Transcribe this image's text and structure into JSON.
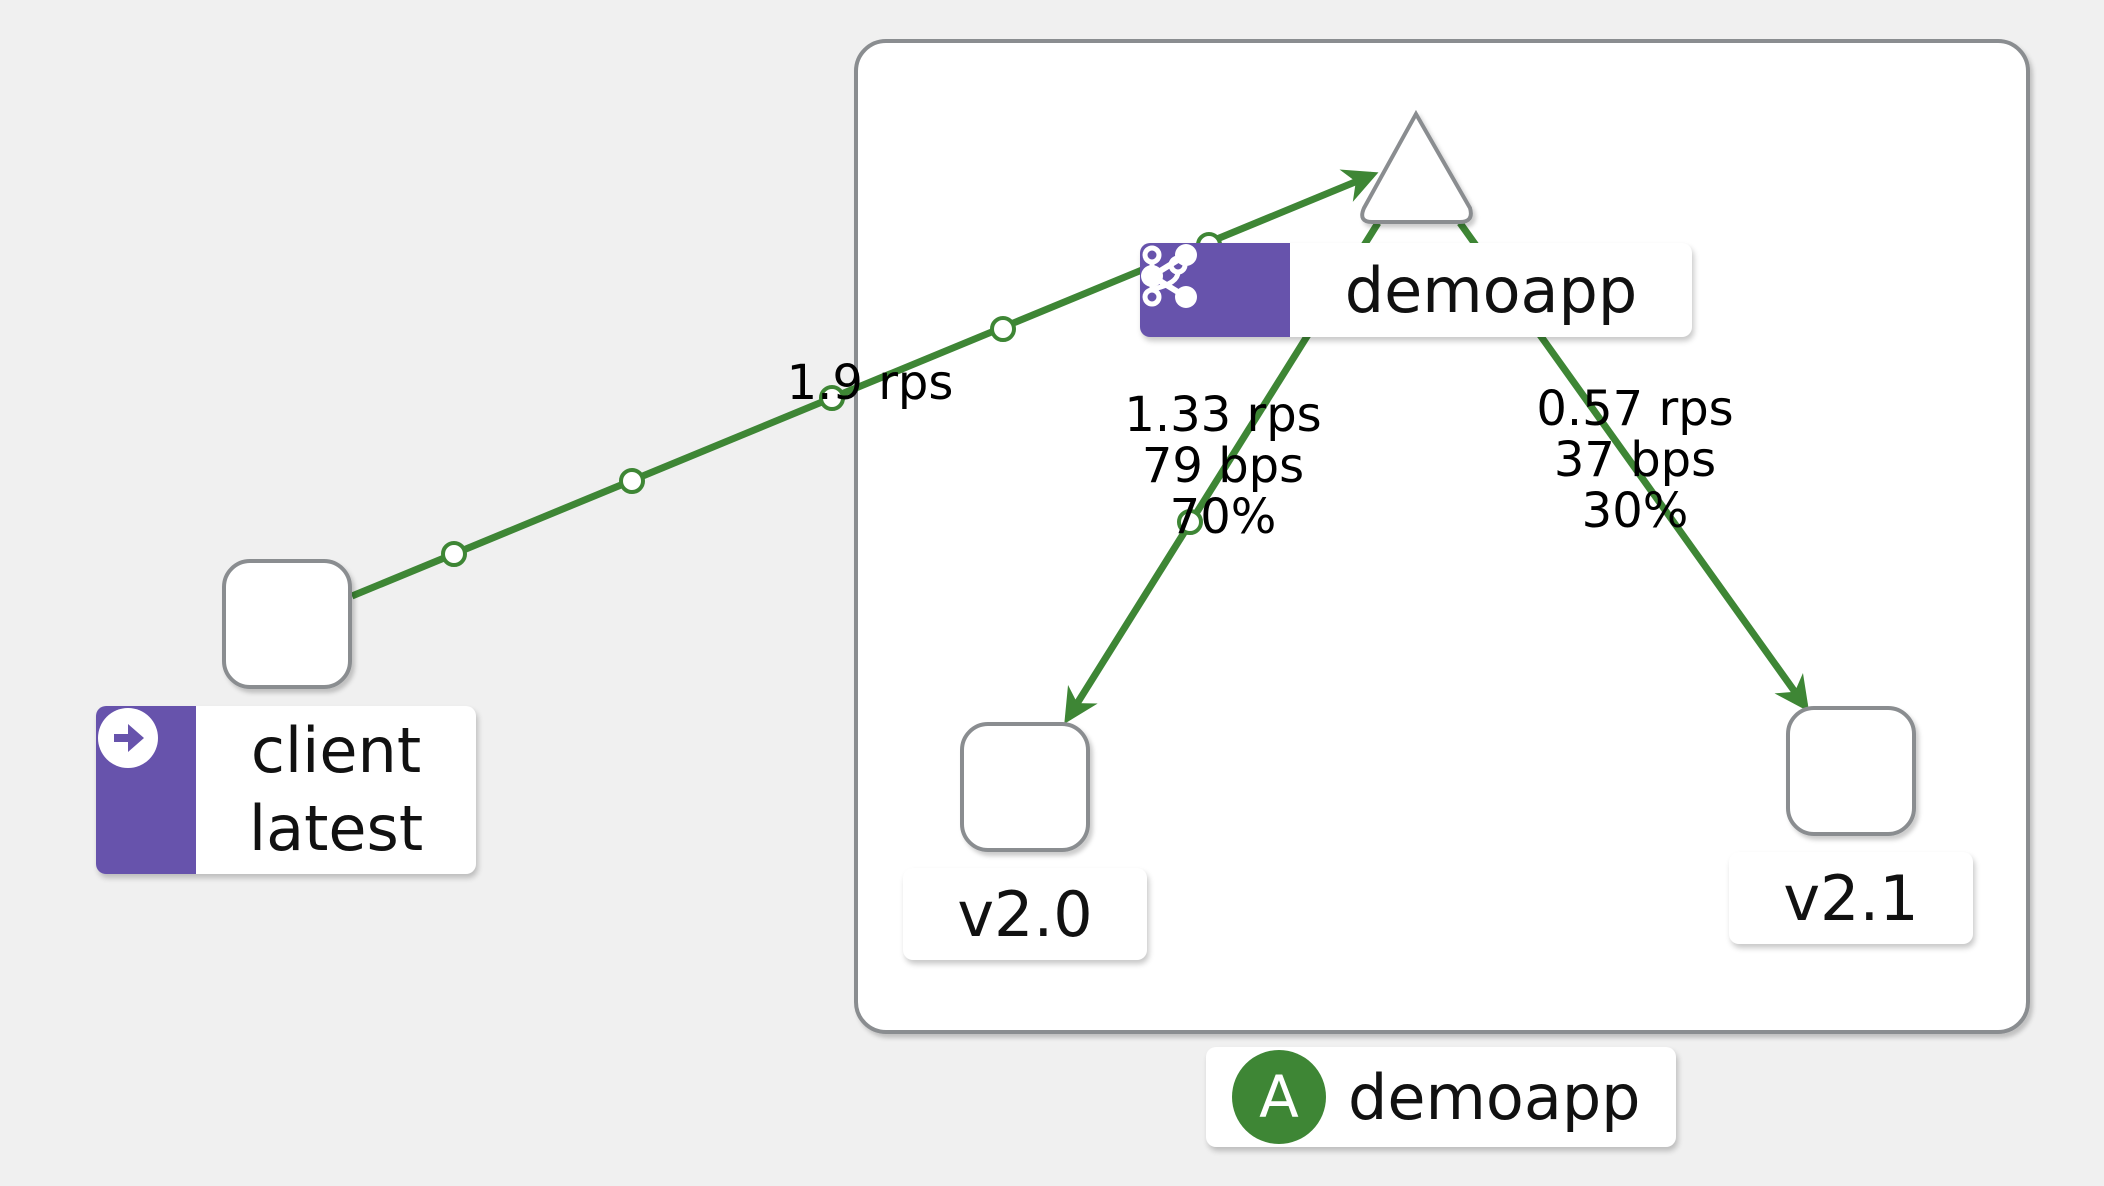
{
  "colors": {
    "edge": "#3e8635",
    "purple": "#6753ac",
    "app_badge": "#3e8635",
    "node_border": "#8a8d90",
    "group_border": "#8a8d90"
  },
  "nodes": {
    "client": {
      "line1": "client",
      "line2": "latest",
      "icon": "arrow-right-circle-icon"
    },
    "service": {
      "label": "demoapp",
      "icons": [
        "virtual-service-branch-icon",
        "share-icon"
      ]
    },
    "v20": {
      "label": "v2.0"
    },
    "v21": {
      "label": "v2.1"
    }
  },
  "group": {
    "label": "demoapp",
    "badge": "A"
  },
  "edges": {
    "client_to_service": {
      "rate": "1.9 rps"
    },
    "service_to_v20": {
      "rate": "1.33 rps",
      "throughput": "79 bps",
      "percent": "70%"
    },
    "service_to_v21": {
      "rate": "0.57 rps",
      "throughput": "37 bps",
      "percent": "30%"
    }
  }
}
